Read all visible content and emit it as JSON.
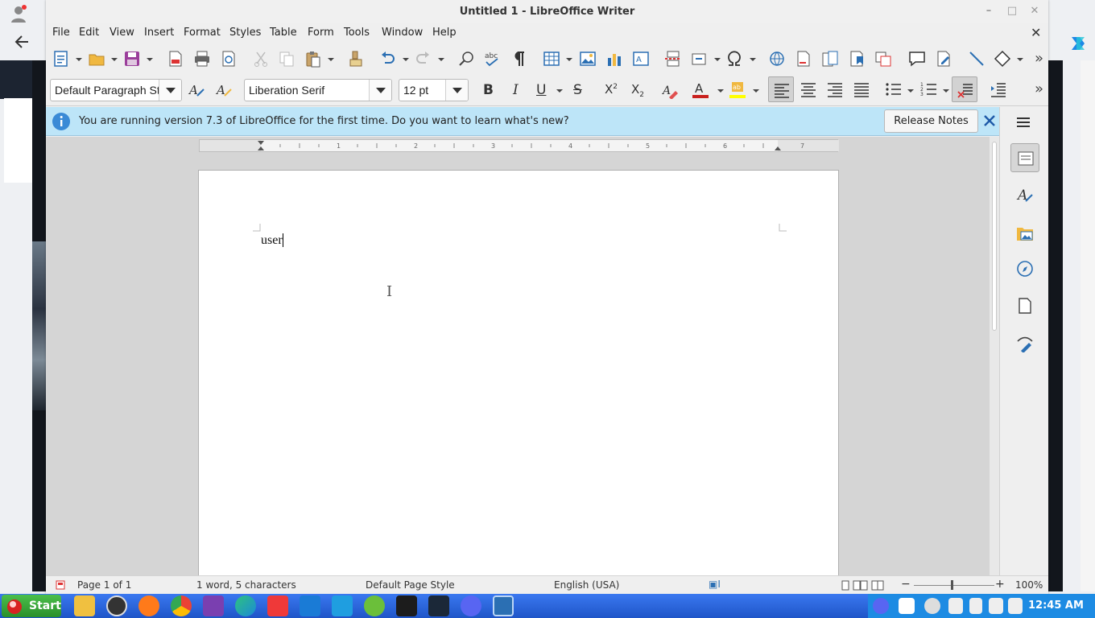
{
  "window": {
    "title": "Untitled 1 - LibreOffice Writer"
  },
  "menu": [
    "File",
    "Edit",
    "View",
    "Insert",
    "Format",
    "Styles",
    "Table",
    "Form",
    "Tools",
    "Window",
    "Help"
  ],
  "formatting": {
    "paragraph_style": "Default Paragraph St",
    "font_name": "Liberation Serif",
    "font_size": "12 pt"
  },
  "infobar": {
    "message": "You are running version 7.3 of LibreOffice for the first time. Do you want to learn what's new?",
    "button_label": "Release Notes"
  },
  "document": {
    "text": "user"
  },
  "status": {
    "page": "Page 1 of 1",
    "words": "1 word, 5 characters",
    "page_style": "Default Page Style",
    "language": "English (USA)",
    "zoom": "100%"
  },
  "taskbar": {
    "start_label": "Start",
    "clock": "12:45 AM"
  },
  "colors": {
    "accent": "#1e72c8",
    "infobar": "#bde5f8",
    "taskbar": "#2a5fd6"
  }
}
